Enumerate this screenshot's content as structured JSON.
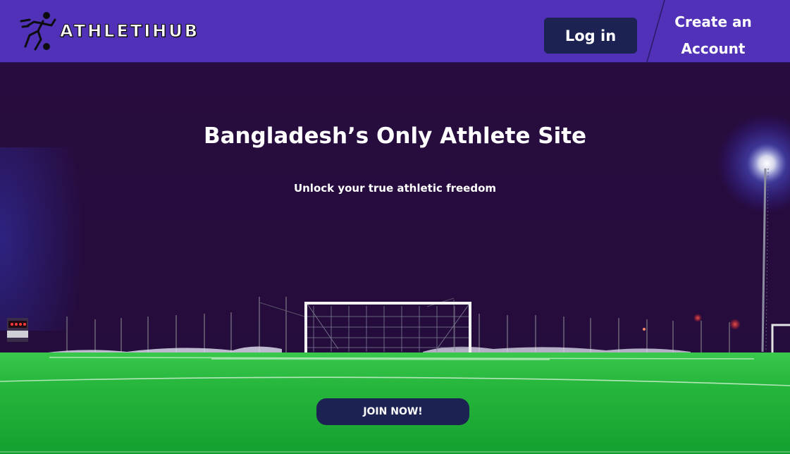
{
  "header": {
    "brand_name": "ATHLETIHUB",
    "logo_icon": "soccer-player-icon",
    "login_label": "Log in",
    "create_account_line1": "Create an",
    "create_account_line2": "Account"
  },
  "hero": {
    "title": "Bangladesh’s Only Athlete Site",
    "subtitle": "Unlock your true athletic freedom",
    "cta_label": "JOIN NOW!",
    "background_image": "night-football-pitch-goal"
  },
  "colors": {
    "header_bg": "#5031b8",
    "button_bg": "#1c2353",
    "sky": "#260d3c",
    "pitch": "#1fae37"
  }
}
